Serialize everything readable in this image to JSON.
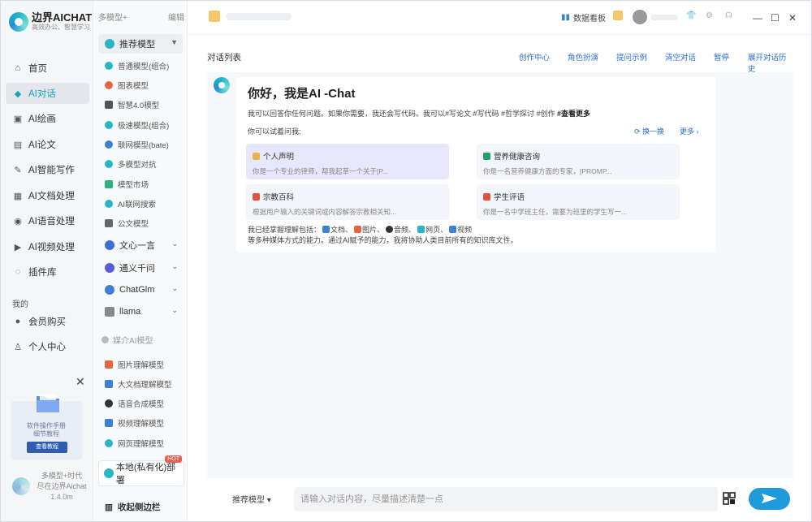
{
  "app": {
    "name": "边界AICHAT",
    "slogan": "高效办公、智慧学习"
  },
  "nav": {
    "items": [
      {
        "label": "首页",
        "icon": "home-icon"
      },
      {
        "label": "AI对话",
        "icon": "cube-icon",
        "active": true
      },
      {
        "label": "AI绘画",
        "icon": "image-icon"
      },
      {
        "label": "AI论文",
        "icon": "document-icon"
      },
      {
        "label": "AI智能写作",
        "icon": "pen-icon"
      },
      {
        "label": "AI文档处理",
        "icon": "file-icon"
      },
      {
        "label": "AI语音处理",
        "icon": "voice-icon"
      },
      {
        "label": "AI视频处理",
        "icon": "video-icon"
      },
      {
        "label": "插件库",
        "icon": "bulb-icon"
      }
    ],
    "section_mine": "我的",
    "mine_items": [
      {
        "label": "会员购买",
        "icon": "user-icon"
      },
      {
        "label": "个人中心",
        "icon": "person-icon"
      }
    ],
    "promo": {
      "line1": "软件操作手册",
      "line2": "细节教程",
      "button": "查看教程"
    },
    "version": {
      "line1": "多模型+时代",
      "line2": "尽在边界Aichat",
      "line3": "1.4.0m"
    }
  },
  "models": {
    "header": "多模型+",
    "edit": "编辑",
    "recommend": "推荐模型",
    "items": [
      "普通模型(组合)",
      "图表模型",
      "智慧4.0模型",
      "极速模型(组合)",
      "联网模型(bate)",
      "多模型对抗",
      "模型市场",
      "AI联网搜索",
      "公文模型"
    ],
    "groups": [
      "文心一言",
      "通义千问",
      "ChatGlm",
      "llama"
    ],
    "media_section": "媒介AI模型",
    "media": [
      "图片理解模型",
      "大文档理解模型",
      "语音合成模型",
      "视频理解模型",
      "网页理解模型"
    ],
    "local": "本地(私有化)部署",
    "hot": "HOT",
    "collapse": "收起侧边栏"
  },
  "topbar": {
    "dashboard": "数据看板"
  },
  "main": {
    "list_title": "对话列表",
    "tabs": [
      "创作中心",
      "角色扮演",
      "提问示例",
      "清空对话",
      "暂停",
      "展开对话历史"
    ],
    "greeting": "你好，我是AI -Chat",
    "desc": "我可以回答你任何问题。如果你需要，我还会写代码。我可以#写论文 #写代码 #哲学探讨 #创作",
    "desc_more": "#查看更多",
    "ask": "你可以试着问我:",
    "swap": "换一换",
    "more": "更多",
    "suggestions": [
      {
        "title": "个人声明",
        "desc": "你是一个专业的律师，帮我起草一个关于[P...",
        "color": "#e9b54a"
      },
      {
        "title": "营养健康咨询",
        "desc": "你是一名营养健康方面的专家，[PROMP...",
        "color": "#22a06b"
      },
      {
        "title": "宗教百科",
        "desc": "根据用户输入的关键词或内容解答宗教相关知...",
        "color": "#e0533f"
      },
      {
        "title": "学生评语",
        "desc": "你是一名中学班主任，需要为班里的学生写一...",
        "color": "#e0533f"
      }
    ],
    "caps_prefix": "我已经掌握理解包括：",
    "caps": [
      "文档、",
      "图片、",
      "音频、",
      "网页、",
      "视频"
    ],
    "caps_line2": "等多种媒体方式的能力。通过AI赋予的能力，我将协助人类目前所有的知识库文件。"
  },
  "input": {
    "model": "推荐模型 ▾",
    "placeholder": "请输入对话内容，尽量描述清楚一点"
  }
}
